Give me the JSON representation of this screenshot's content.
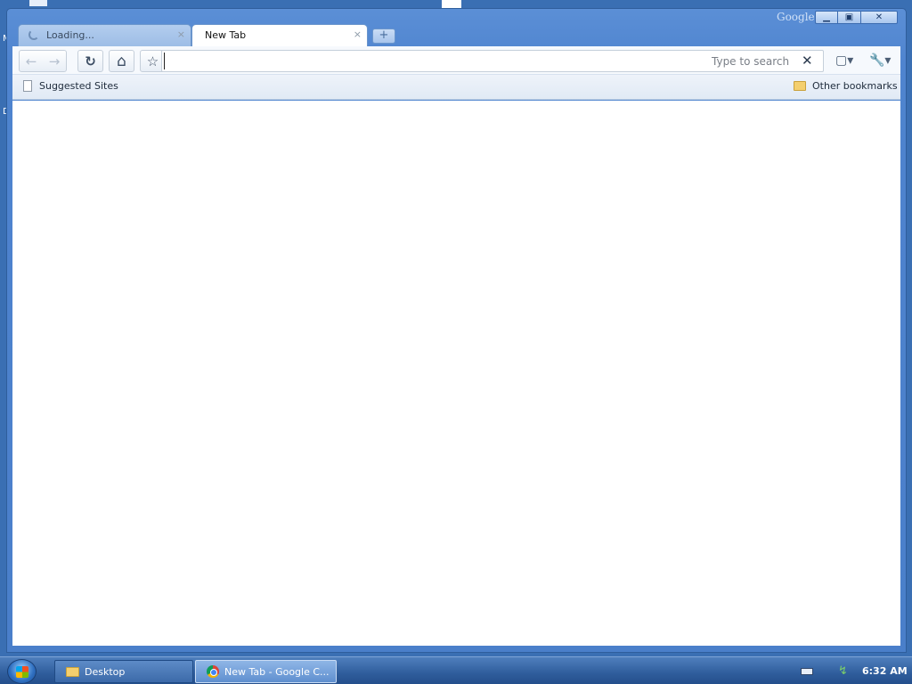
{
  "window": {
    "brand": "Google",
    "controls": {
      "minimize": "▁",
      "maximize": "▣",
      "close": "✕"
    }
  },
  "tabs": [
    {
      "title": "Loading...",
      "state": "loading",
      "close_glyph": "×"
    },
    {
      "title": "New Tab",
      "state": "active",
      "close_glyph": "×"
    }
  ],
  "new_tab_glyph": "+",
  "toolbar": {
    "back_icon": "back-arrow-icon",
    "back_glyph": "←",
    "forward_icon": "forward-arrow-icon",
    "forward_glyph": "→",
    "reload_glyph": "↻",
    "home_glyph": "⌂",
    "star_glyph": "☆",
    "omnibox": {
      "value": "",
      "hint": "Type to search",
      "clear_glyph": "✕"
    },
    "page_menu_glyph": "▢▾",
    "wrench_menu_glyph": "🔧▾"
  },
  "bookmarks": {
    "left_item": "Suggested Sites",
    "right_item": "Other bookmarks"
  },
  "taskbar": {
    "tasks": [
      {
        "label": "Desktop",
        "icon": "folder-icon"
      },
      {
        "label": "New Tab - Google C...",
        "icon": "chrome-icon"
      }
    ],
    "tray_net_glyph": "↯",
    "clock": "6:32 AM"
  },
  "desktop": {
    "partial_letter_1": "M",
    "partial_letter_2": "D"
  }
}
